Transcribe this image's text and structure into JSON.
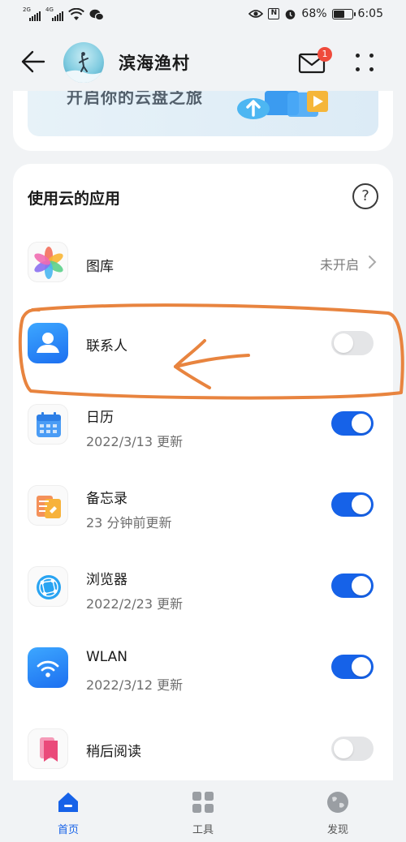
{
  "status_bar": {
    "sim1_tag": "2G",
    "sim2_tag": "4G",
    "battery_percent": "68%",
    "battery_level": 0.68,
    "time": "6:05"
  },
  "header": {
    "title": "滨海渔村",
    "mail_badge_count": "1"
  },
  "banner": {
    "text": "开启你的云盘之旅"
  },
  "apps_card": {
    "title": "使用云的应用",
    "help_label": "?",
    "items": [
      {
        "name": "图库",
        "status": "未开启",
        "icon": "gallery-flower-icon"
      },
      {
        "name": "联系人",
        "toggle": false,
        "icon": "contacts-person-icon"
      },
      {
        "name": "日历",
        "subtitle": "2022/3/13 更新",
        "toggle": true,
        "icon": "calendar-icon"
      },
      {
        "name": "备忘录",
        "subtitle": "23 分钟前更新",
        "toggle": true,
        "icon": "notepad-icon"
      },
      {
        "name": "浏览器",
        "subtitle": "2022/2/23 更新",
        "toggle": true,
        "icon": "browser-globe-icon"
      },
      {
        "name": "WLAN",
        "subtitle": "2022/3/12 更新",
        "toggle": true,
        "icon": "wifi-icon"
      },
      {
        "name": "稍后阅读",
        "toggle": false,
        "icon": "read-later-bookmark-icon"
      }
    ]
  },
  "bottom_nav": {
    "items": [
      {
        "label": "首页",
        "icon": "home-icon",
        "active": true
      },
      {
        "label": "工具",
        "icon": "tools-grid-icon",
        "active": false
      },
      {
        "label": "发现",
        "icon": "discover-globe-icon",
        "active": false
      }
    ]
  },
  "colors": {
    "accent": "#1662e8",
    "annotation": "#e8843f",
    "badge": "#ef4a3b"
  }
}
